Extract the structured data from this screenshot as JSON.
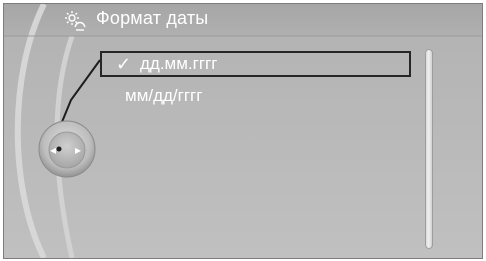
{
  "header": {
    "title": "Формат даты",
    "icon": "settings-gear-icon"
  },
  "menu": {
    "items": [
      {
        "label": "дд.мм.гггг",
        "checked": true,
        "selected": true,
        "check_mark": "✓"
      },
      {
        "label": "мм/дд/гггг",
        "checked": false,
        "selected": false
      }
    ]
  },
  "controller": {
    "left_arrow": "◂",
    "right_arrow": "▸"
  },
  "colors": {
    "background": "#b9b9b9",
    "text": "#ffffff",
    "selection_frame": "#262626"
  }
}
